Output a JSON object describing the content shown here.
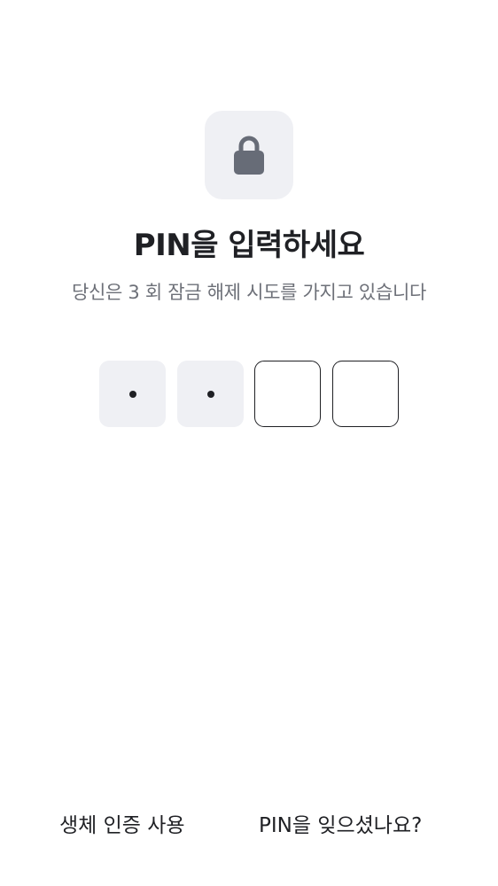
{
  "screen": {
    "title": "PIN을 입력하세요",
    "subtitle": "당신은 3 회 잠금 해제 시도를 가지고 있습니다"
  },
  "lock_icon": {
    "icon": "lock-icon",
    "tile_color": "#eff0f4",
    "icon_color": "#676c77"
  },
  "pin": {
    "length": 4,
    "entered": 2,
    "dot_glyph": "•"
  },
  "actions": {
    "biometric_label": "생체 인증 사용",
    "forgot_label": "PIN을 잊으셨나요?"
  }
}
